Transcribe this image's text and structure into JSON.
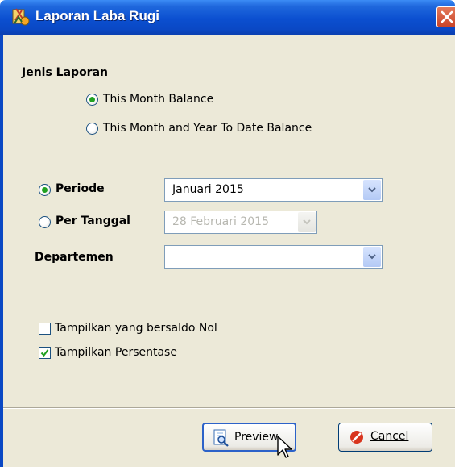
{
  "window": {
    "title": "Laporan Laba Rugi",
    "icon": "report-app-icon"
  },
  "jenis_laporan": {
    "heading": "Jenis Laporan",
    "options": [
      {
        "label": "This Month Balance",
        "selected": true
      },
      {
        "label": "This Month and Year To Date Balance",
        "selected": false
      }
    ]
  },
  "periode": {
    "label": "Periode",
    "selected": true,
    "value": "Januari 2015"
  },
  "per_tanggal": {
    "label": "Per Tanggal",
    "selected": false,
    "value": "28 Februari 2015",
    "enabled": false
  },
  "departemen": {
    "label": "Departemen",
    "value": ""
  },
  "checkboxes": [
    {
      "label": "Tampilkan yang bersaldo Nol",
      "checked": false
    },
    {
      "label": "Tampilkan Persentase",
      "checked": true
    }
  ],
  "buttons": {
    "preview": "Preview",
    "cancel": "Cancel"
  },
  "colors": {
    "titlebar": "#0a48c4",
    "client": "#ece9d8",
    "radio_dot": "#21a121",
    "close": "#c9442a"
  }
}
